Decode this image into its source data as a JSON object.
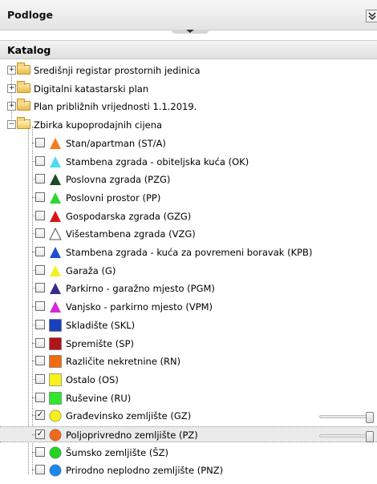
{
  "panel": {
    "title": "Podloge",
    "collapse_icon": "double-chevron-down-icon"
  },
  "catalog": {
    "title": "Katalog"
  },
  "folders": [
    {
      "label": "Središnji registar prostornih jedinica",
      "expanded": false
    },
    {
      "label": "Digitalni katastarski plan",
      "expanded": false
    },
    {
      "label": "Plan približnih vrijednosti 1.1.2019.",
      "expanded": false
    },
    {
      "label": "Zbirka kupoprodajnih cijena",
      "expanded": true
    }
  ],
  "items": [
    {
      "label": "Stan/apartman (ST/A)",
      "symbol": "triangle",
      "fill": "#f47d20",
      "checked": false,
      "slider": false
    },
    {
      "label": "Stambena zgrada - obiteljska kuća (OK)",
      "symbol": "triangle",
      "fill": "#4fd9f2",
      "checked": false,
      "slider": false
    },
    {
      "label": "Poslovna zgrada (PZG)",
      "symbol": "triangle",
      "fill": "#1d4a2a",
      "checked": false,
      "slider": false
    },
    {
      "label": "Poslovni prostor (PP)",
      "symbol": "triangle",
      "fill": "#2fd62f",
      "checked": false,
      "slider": false
    },
    {
      "label": "Gospodarska zgrada (GZG)",
      "symbol": "triangle",
      "fill": "#d81515",
      "checked": false,
      "slider": false
    },
    {
      "label": "Višestambena zgrada (VZG)",
      "symbol": "triangle",
      "fill": "#ffffff",
      "checked": false,
      "slider": false
    },
    {
      "label": "Stambena zgrada - kuća za povremeni boravak (KPB)",
      "symbol": "triangle",
      "fill": "#1f4fd1",
      "checked": false,
      "slider": false
    },
    {
      "label": "Garaža (G)",
      "symbol": "triangle",
      "fill": "#f5ee2a",
      "checked": false,
      "slider": false
    },
    {
      "label": "Parkirno - garažno mjesto (PGM)",
      "symbol": "triangle",
      "fill": "#3a2a8c",
      "checked": false,
      "slider": false
    },
    {
      "label": "Vanjsko - parkirno mjesto (VPM)",
      "symbol": "triangle",
      "fill": "#d52ad6",
      "checked": false,
      "slider": false
    },
    {
      "label": "Skladište (SKL)",
      "symbol": "square",
      "fill": "#1a3fbf",
      "checked": false,
      "slider": false
    },
    {
      "label": "Spremište (SP)",
      "symbol": "square",
      "fill": "#b0151b",
      "checked": false,
      "slider": false
    },
    {
      "label": "Različite nekretnine (RN)",
      "symbol": "square",
      "fill": "#f06a10",
      "checked": false,
      "slider": false
    },
    {
      "label": "Ostalo (OS)",
      "symbol": "square",
      "fill": "#f7f21c",
      "checked": false,
      "slider": false
    },
    {
      "label": "Ruševine (RU)",
      "symbol": "square",
      "fill": "#2ee82e",
      "checked": false,
      "slider": false
    },
    {
      "label": "Građevinsko zemljište (GZ)",
      "symbol": "circle",
      "fill": "#f7ef18",
      "checked": true,
      "slider": true,
      "opacity": 1.0
    },
    {
      "label": "Poljoprivredno zemljište (PZ)",
      "symbol": "circle",
      "fill": "#f06818",
      "checked": true,
      "slider": true,
      "opacity": 1.0,
      "selected": true
    },
    {
      "label": "Šumsko zemljište (ŠZ)",
      "symbol": "circle",
      "fill": "#22d322",
      "checked": false,
      "slider": false
    },
    {
      "label": "Prirodno neplodno zemljište (PNZ)",
      "symbol": "circle",
      "fill": "#1b86ee",
      "checked": false,
      "slider": false
    }
  ]
}
